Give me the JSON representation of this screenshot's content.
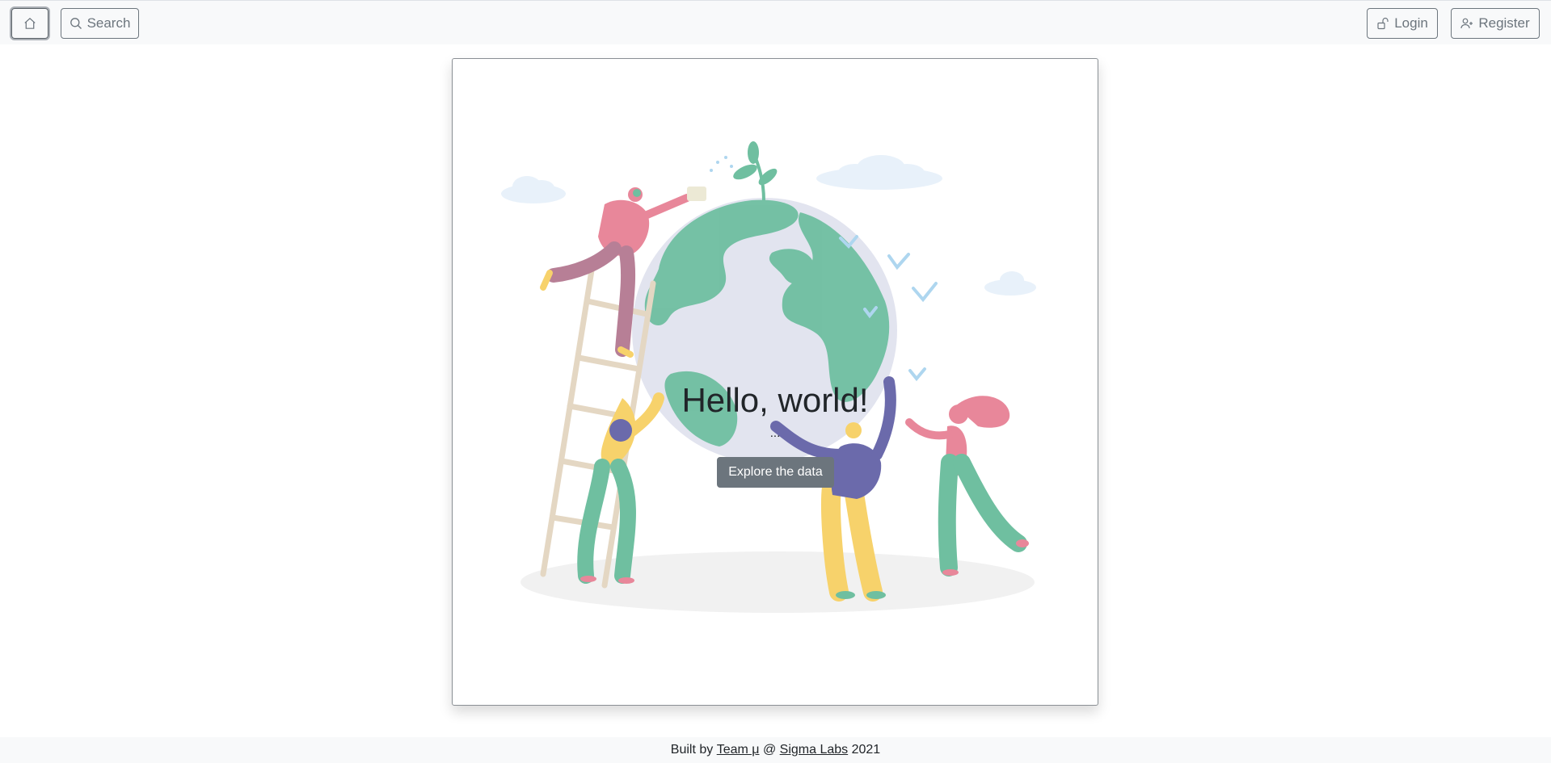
{
  "navbar": {
    "home_icon": "house-icon",
    "search_icon": "search-icon",
    "search_label": "Search",
    "login_icon": "unlock-icon",
    "login_label": "Login",
    "register_icon": "person-plus-icon",
    "register_label": "Register"
  },
  "hero": {
    "title": "Hello, world!",
    "subtitle": "...",
    "button_label": "Explore the data"
  },
  "footer": {
    "prefix": "Built by",
    "team_link": "Team μ",
    "at": "@",
    "org_link": "Sigma Labs",
    "year": "2021"
  },
  "colors": {
    "navbar_bg": "#f8f9fa",
    "button_outline": "#6c757d",
    "explore_button_bg": "#6c757d",
    "globe_land": "#6fbfa0",
    "globe_water": "#e2e4ef",
    "accent_pink": "#e8879a",
    "accent_yellow": "#f7d26b",
    "accent_purple": "#6b6aab"
  }
}
